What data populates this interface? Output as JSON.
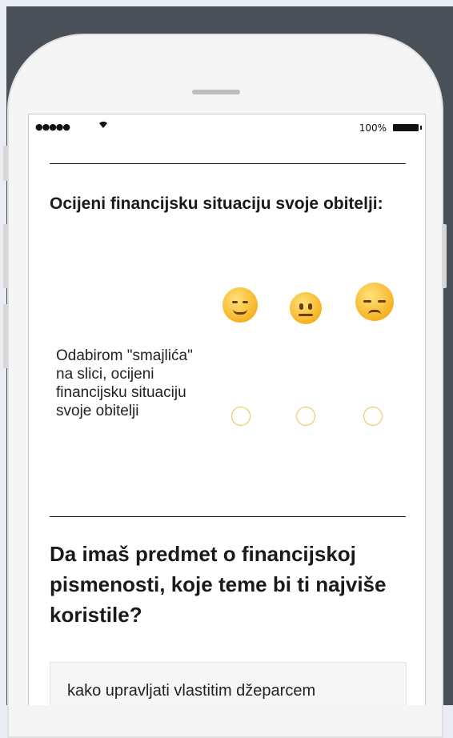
{
  "status_bar": {
    "signal": "●●●●●",
    "wifi_icon": "wifi-icon",
    "battery": "100%"
  },
  "question1": {
    "title": "Ocijeni financijsku situaciju svoje obitelji:",
    "emojis": [
      "smiling-face-icon",
      "neutral-face-icon",
      "pensive-face-icon"
    ],
    "row_label": "Odabirom \"smajlića\" na slici, ocijeni financijsku situaciju svoje obitelji"
  },
  "question2": {
    "title": "Da imaš predmet o financijskoj pismenosti, koje teme bi ti najviše koristile?",
    "answer": "kako upravljati vlastitim džeparcem"
  },
  "colors": {
    "radio_border": "#f2c14e",
    "backdrop": "#4a5058"
  }
}
